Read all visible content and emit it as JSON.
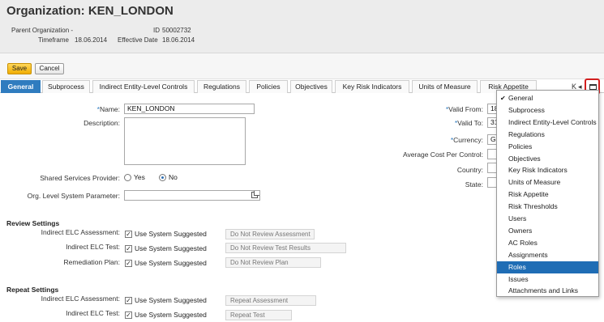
{
  "header": {
    "title": "Organization: KEN_LONDON",
    "parent_org_label": "Parent Organization -",
    "id_label": "ID",
    "id_value": "50002732",
    "timeframe_label": "Timeframe",
    "timeframe_value": "18.06.2014",
    "effective_date_label": "Effective Date",
    "effective_date_value": "18.06.2014"
  },
  "toolbar": {
    "save_label": "Save",
    "cancel_label": "Cancel"
  },
  "tabs": [
    {
      "label": "General",
      "active": true
    },
    {
      "label": "Subprocess"
    },
    {
      "label": "Indirect Entity-Level Controls"
    },
    {
      "label": "Regulations"
    },
    {
      "label": "Policies"
    },
    {
      "label": "Objectives"
    },
    {
      "label": "Key Risk Indicators"
    },
    {
      "label": "Units of Measure"
    },
    {
      "label": "Risk Appetite"
    }
  ],
  "tab_nav": {
    "first": "K",
    "prev": "◂"
  },
  "form": {
    "name_label": "Name:",
    "name_value": "KEN_LONDON",
    "description_label": "Description:",
    "shared_services_label": "Shared Services Provider:",
    "yes_label": "Yes",
    "no_label": "No",
    "shared_services_value": "No",
    "org_level_label": "Org. Level System Parameter:",
    "valid_from_label": "Valid From:",
    "valid_from_value": "18",
    "valid_to_label": "Valid To:",
    "valid_to_value": "31",
    "currency_label": "Currency:",
    "currency_value": "GI",
    "avg_cost_label": "Average Cost Per Control:",
    "country_label": "Country:",
    "state_label": "State:"
  },
  "review_settings": {
    "title": "Review Settings",
    "rows": [
      {
        "label": "Indirect ELC Assessment:",
        "checkbox_label": "Use System Suggested",
        "checked": true,
        "value": "Do Not Review Assessment"
      },
      {
        "label": "Indirect ELC Test:",
        "checkbox_label": "Use System Suggested",
        "checked": true,
        "value": "Do Not Review Test Results"
      },
      {
        "label": "Remediation Plan:",
        "checkbox_label": "Use System Suggested",
        "checked": true,
        "value": "Do Not Review Plan"
      }
    ]
  },
  "repeat_settings": {
    "title": "Repeat Settings",
    "rows": [
      {
        "label": "Indirect ELC Assessment:",
        "checkbox_label": "Use System Suggested",
        "checked": true,
        "value": "Repeat Assessment"
      },
      {
        "label": "Indirect ELC Test:",
        "checkbox_label": "Use System Suggested",
        "checked": true,
        "value": "Repeat Test"
      }
    ]
  },
  "dropdown": {
    "check_mark": "✔",
    "items": [
      "General",
      "Subprocess",
      "Indirect Entity-Level Controls",
      "Regulations",
      "Policies",
      "Objectives",
      "Key Risk Indicators",
      "Units of Measure",
      "Risk Appetite",
      "Risk Thresholds",
      "Users",
      "Owners",
      "AC Roles",
      "Assignments",
      "Roles",
      "Issues",
      "Attachments and Links"
    ],
    "checked_item": "General",
    "highlighted_item": "Roles"
  },
  "colors": {
    "accent": "#2f7cbf",
    "save_button": "#f0ad00",
    "highlight": "#1f6db5",
    "callout": "#d21f1f"
  },
  "icons": {
    "value_help": "value-help-icon",
    "overflow": "tab-overflow-icon",
    "check": "check-icon"
  }
}
